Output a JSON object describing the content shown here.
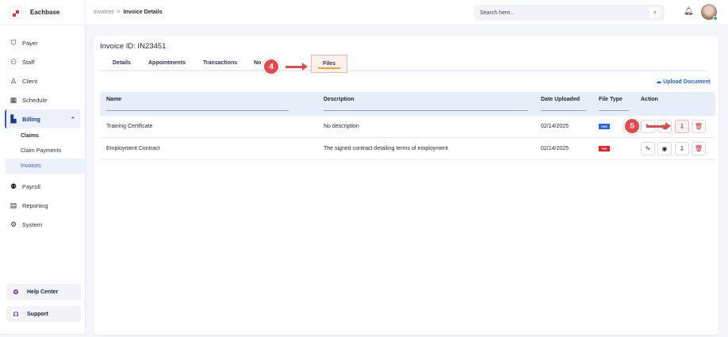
{
  "brand": {
    "name": "Eachbase",
    "accent": "#e8293b"
  },
  "sidebar": {
    "items": [
      {
        "label": "Payer",
        "icon": "shield-icon"
      },
      {
        "label": "Staff",
        "icon": "users-icon"
      },
      {
        "label": "Client",
        "icon": "user-icon"
      },
      {
        "label": "Schedule",
        "icon": "calendar-icon"
      },
      {
        "label": "Billing",
        "icon": "billing-icon"
      },
      {
        "label": "Payroll",
        "icon": "payroll-icon"
      },
      {
        "label": "Reporting",
        "icon": "clipboard-icon"
      },
      {
        "label": "System",
        "icon": "gear-icon"
      }
    ],
    "billing_sub": [
      "Claims",
      "Claim Payments",
      "Invoices"
    ],
    "help": "Help Center",
    "support": "Support"
  },
  "topbar": {
    "breadcrumb": [
      "Invoices",
      "Invoice Details"
    ],
    "search_placeholder": "Search here..."
  },
  "invoice": {
    "label": "Invoice ID:",
    "id": "IN23451"
  },
  "tabs": [
    "Details",
    "Appointments",
    "Transactions",
    "No",
    "Files"
  ],
  "upload_label": "Upload Document",
  "table": {
    "columns": [
      "Name",
      "Description",
      "Date Uploaded",
      "File Type",
      "Action"
    ],
    "rows": [
      {
        "name": "Training Certificate",
        "description": "No description",
        "date": "02/14/2025",
        "type": "PNG",
        "type_color": "#2563eb"
      },
      {
        "name": "Employment Contract",
        "description": "The signed contract detailing terms of employment",
        "date": "02/14/2025",
        "type": "PDF",
        "type_color": "#ef1c24"
      }
    ]
  },
  "annotations": [
    "4",
    "5"
  ]
}
